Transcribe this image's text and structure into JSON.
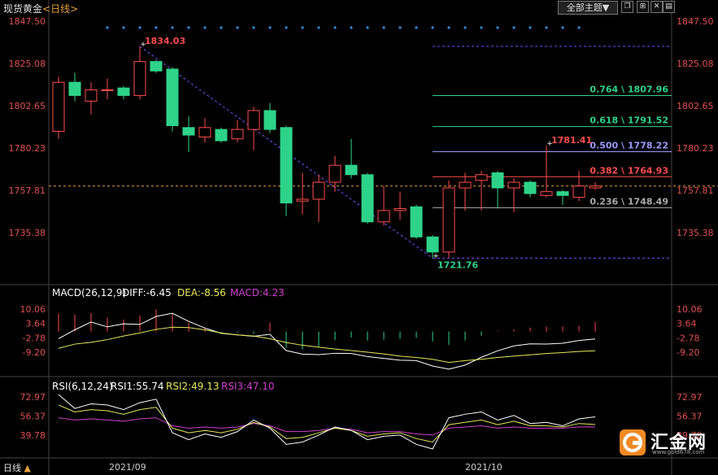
{
  "header": {
    "title": "现货黄金",
    "subtitle": "<日线>",
    "theme_button": "全部主题▼"
  },
  "footer": {
    "period": "日线",
    "arrow": "▲"
  },
  "logo": {
    "text": "汇金网",
    "url": "www.gold678.com"
  },
  "colors": {
    "up": "#ff4d4d",
    "down": "#2ed38a",
    "fib": "#7c4dff"
  },
  "chart_data": [
    {
      "type": "candlestick",
      "title": "现货黄金 <日线>",
      "y_ticks": [
        "1847.50",
        "1825.08",
        "1802.65",
        "1780.23",
        "1757.81",
        "1735.38"
      ],
      "ylim": [
        1712,
        1850
      ],
      "x_labels": [
        "2021/09",
        "2021/10"
      ],
      "current_price": 1760,
      "candles": [
        {
          "o": 1789,
          "h": 1818,
          "l": 1785,
          "c": 1815
        },
        {
          "o": 1815,
          "h": 1820,
          "l": 1805,
          "c": 1808
        },
        {
          "o": 1805,
          "h": 1815,
          "l": 1798,
          "c": 1811
        },
        {
          "o": 1811,
          "h": 1817,
          "l": 1806,
          "c": 1811
        },
        {
          "o": 1812,
          "h": 1813,
          "l": 1806,
          "c": 1808
        },
        {
          "o": 1808,
          "h": 1834.03,
          "l": 1806,
          "c": 1826
        },
        {
          "o": 1826,
          "h": 1827,
          "l": 1820,
          "c": 1821
        },
        {
          "o": 1822,
          "h": 1823,
          "l": 1789,
          "c": 1792
        },
        {
          "o": 1791,
          "h": 1797,
          "l": 1778,
          "c": 1787
        },
        {
          "o": 1786,
          "h": 1796,
          "l": 1783,
          "c": 1791
        },
        {
          "o": 1790,
          "h": 1791,
          "l": 1783,
          "c": 1784
        },
        {
          "o": 1785,
          "h": 1795,
          "l": 1783,
          "c": 1790
        },
        {
          "o": 1790,
          "h": 1802,
          "l": 1779,
          "c": 1800
        },
        {
          "o": 1800,
          "h": 1804,
          "l": 1788,
          "c": 1790
        },
        {
          "o": 1791,
          "h": 1792,
          "l": 1744,
          "c": 1751
        },
        {
          "o": 1752,
          "h": 1767,
          "l": 1745,
          "c": 1753
        },
        {
          "o": 1753,
          "h": 1766,
          "l": 1741,
          "c": 1762
        },
        {
          "o": 1762,
          "h": 1776,
          "l": 1757,
          "c": 1771
        },
        {
          "o": 1771,
          "h": 1785,
          "l": 1764,
          "c": 1766
        },
        {
          "o": 1766,
          "h": 1767,
          "l": 1740,
          "c": 1741
        },
        {
          "o": 1741,
          "h": 1760,
          "l": 1739,
          "c": 1747
        },
        {
          "o": 1747,
          "h": 1757,
          "l": 1742,
          "c": 1748
        },
        {
          "o": 1749,
          "h": 1750,
          "l": 1732,
          "c": 1733
        },
        {
          "o": 1733,
          "h": 1734,
          "l": 1721.76,
          "c": 1725
        },
        {
          "o": 1725,
          "h": 1763,
          "l": 1722,
          "c": 1759
        },
        {
          "o": 1759,
          "h": 1767,
          "l": 1747,
          "c": 1762
        },
        {
          "o": 1763,
          "h": 1768,
          "l": 1747,
          "c": 1766
        },
        {
          "o": 1767,
          "h": 1768,
          "l": 1748,
          "c": 1759
        },
        {
          "o": 1759,
          "h": 1764,
          "l": 1746,
          "c": 1762
        },
        {
          "o": 1762,
          "h": 1763,
          "l": 1754,
          "c": 1756
        },
        {
          "o": 1755,
          "h": 1781.41,
          "l": 1754,
          "c": 1757
        },
        {
          "o": 1757,
          "h": 1758,
          "l": 1750,
          "c": 1755
        },
        {
          "o": 1754,
          "h": 1768,
          "l": 1752,
          "c": 1760
        },
        {
          "o": 1759,
          "h": 1762,
          "l": 1758,
          "c": 1760
        }
      ],
      "annotations": [
        {
          "text": "1834.03",
          "price": 1834.03,
          "candle": 5
        },
        {
          "text": "1721.76",
          "price": 1721.76,
          "candle": 23
        },
        {
          "text": "1781.41",
          "price": 1781.41,
          "candle": 30
        }
      ],
      "fib_levels": [
        {
          "label": "0.764 \\ 1807.96",
          "price": 1807.96,
          "color": "#2ed38a"
        },
        {
          "label": "0.618 \\ 1791.52",
          "price": 1791.52,
          "color": "#2ed38a"
        },
        {
          "label": "0.500 \\ 1778.22",
          "price": 1778.22,
          "color": "#9a9aff"
        },
        {
          "label": "0.382 \\ 1764.93",
          "price": 1764.93,
          "color": "#ff4d4d"
        },
        {
          "label": "0.236 \\ 1748.49",
          "price": 1748.49,
          "color": "#aaaaaa"
        }
      ]
    },
    {
      "type": "macd",
      "header": "MACD(26,12,9)",
      "diff_label": "DIFF:-6.45",
      "dea_label": "DEA:-8.56",
      "macd_label": "MACD:4.23",
      "y_ticks": [
        "10.06",
        "3.64",
        "-2.78",
        "-9.20"
      ],
      "ylim": [
        -12.5,
        13
      ],
      "diff": [
        -3.2,
        0.8,
        4.3,
        2.1,
        3.5,
        3.2,
        6.8,
        8.2,
        4.6,
        1.6,
        -0.8,
        -1.5,
        -2.1,
        -1.2,
        -8.5,
        -10.1,
        -10.3,
        -9.7,
        -9.8,
        -11.2,
        -12.0,
        -12.8,
        -13.0,
        -15.4,
        -16.8,
        -15.0,
        -11.5,
        -8.6,
        -6.4,
        -5.5,
        -5.6,
        -5.2,
        -4.0,
        -3.3
      ],
      "dea": [
        -7.5,
        -5.6,
        -4.8,
        -3.6,
        -2.0,
        -0.6,
        1.0,
        2.0,
        1.8,
        0.8,
        -0.6,
        -1.5,
        -2.0,
        -3.2,
        -4.9,
        -6.1,
        -7.0,
        -7.8,
        -8.5,
        -9.2,
        -10.0,
        -11.0,
        -11.6,
        -12.4,
        -13.8,
        -13.0,
        -12.4,
        -11.6,
        -11.0,
        -10.4,
        -9.8,
        -9.4,
        -8.9,
        -8.6
      ],
      "macd": [
        8.0,
        7.6,
        8.3,
        6.2,
        5.5,
        7.2,
        10.0,
        8.0,
        4.0,
        1.6,
        -0.4,
        -0.6,
        -1.0,
        4.0,
        -7.2,
        -8.0,
        -6.8,
        -3.8,
        -2.6,
        -4.0,
        -3.6,
        -3.2,
        -2.8,
        -4.4,
        -6.0,
        -4.0,
        -1.8,
        0.4,
        1.0,
        1.8,
        2.2,
        2.4,
        2.6,
        4.23
      ]
    },
    {
      "type": "rsi",
      "header": "RSI(6,12,24)",
      "rsi1_label": "RSI1:55.74",
      "rsi2_label": "RSI2:49.13",
      "rsi3_label": "RSI3:47.10",
      "y_ticks": [
        "72.97",
        "56.37",
        "39.78"
      ],
      "ylim": [
        28,
        80
      ],
      "rsi1": [
        75,
        63,
        67,
        66,
        62,
        68,
        71,
        42,
        36,
        41,
        38,
        43,
        53,
        46,
        32,
        34,
        40,
        47,
        44,
        36,
        39,
        40,
        32,
        28,
        55,
        58,
        60,
        53,
        57,
        50,
        51,
        48,
        54,
        55.74
      ],
      "rsi2": [
        66,
        60,
        62,
        61,
        58,
        62,
        64,
        46,
        42,
        44,
        42,
        45,
        51,
        47,
        37,
        38,
        42,
        46,
        44,
        39,
        41,
        42,
        37,
        34,
        49,
        51,
        53,
        49,
        52,
        48,
        48,
        47,
        50,
        49.13
      ],
      "rsi3": [
        55,
        53,
        54,
        53,
        52,
        54,
        55,
        48,
        46,
        47,
        46,
        47,
        50,
        48,
        43,
        43,
        44,
        46,
        45,
        42,
        43,
        43,
        41,
        40,
        46,
        47,
        48,
        46,
        47,
        46,
        46,
        46,
        47,
        47.1
      ]
    }
  ]
}
